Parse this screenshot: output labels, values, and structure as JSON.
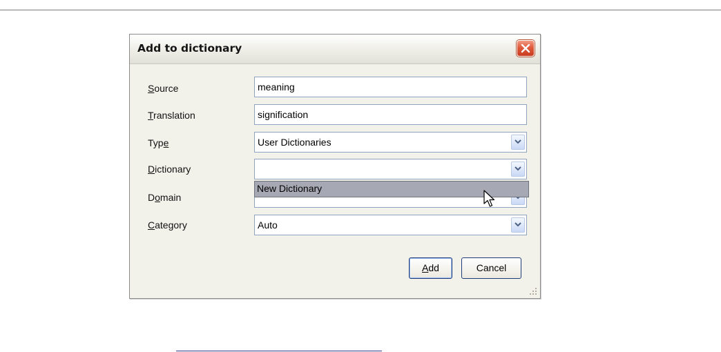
{
  "dialog": {
    "title": "Add to dictionary",
    "close_icon": "close-icon"
  },
  "fields": {
    "source": {
      "label_mnemonic": "S",
      "label_rest": "ource",
      "value": "meaning"
    },
    "translation": {
      "label_mnemonic": "T",
      "label_rest": "ranslation",
      "value": "signification"
    },
    "type": {
      "label_pre": "Typ",
      "label_mnemonic": "e",
      "value": "User Dictionaries"
    },
    "dictionary": {
      "label_mnemonic": "D",
      "label_rest": "ictionary",
      "value": ""
    },
    "domain": {
      "label_pre": "D",
      "label_mnemonic": "o",
      "label_rest": "main",
      "value": ""
    },
    "category": {
      "label_mnemonic": "C",
      "label_rest": "ategory",
      "value": "Auto"
    }
  },
  "dropdown": {
    "options": [
      "New Dictionary"
    ],
    "highlighted": "New Dictionary"
  },
  "buttons": {
    "add_mnemonic": "A",
    "add_rest": "dd",
    "cancel": "Cancel"
  },
  "icons": {
    "combo_arrow": "chevron-down-icon",
    "cursor": "mouse-pointer-icon",
    "grip": "resize-grip-icon"
  },
  "colors": {
    "close_button": "#e05a3c",
    "dropdown_highlight": "#a6a9b4",
    "input_border": "#8fa3bf"
  }
}
